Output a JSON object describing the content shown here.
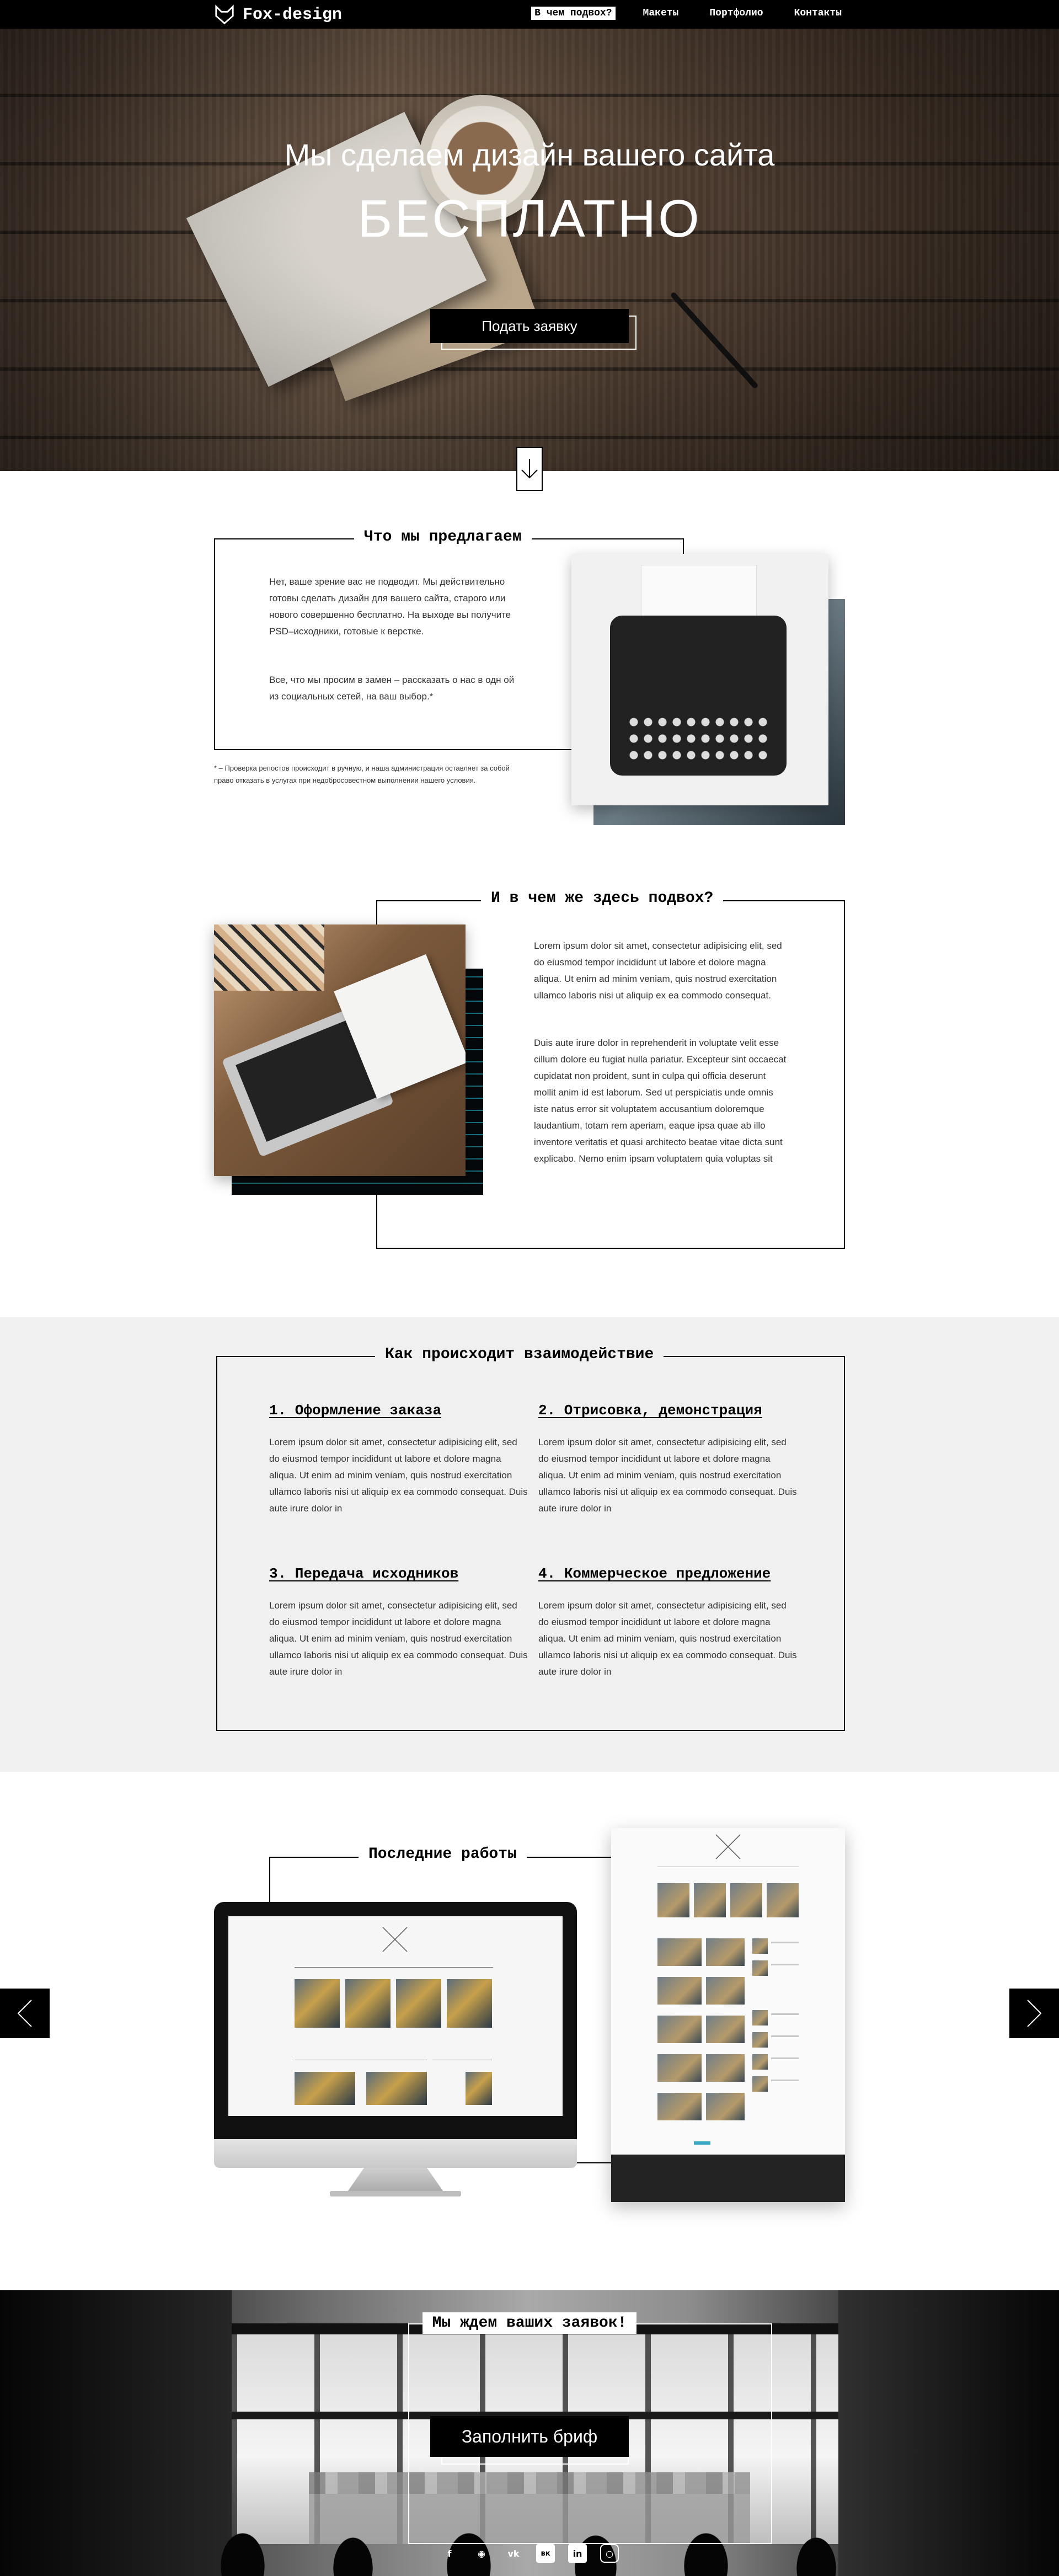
{
  "nav": {
    "brand": "Fox-design",
    "items": [
      {
        "label": "В чем подвох?",
        "active": true
      },
      {
        "label": "Макеты",
        "active": false
      },
      {
        "label": "Портфолио",
        "active": false
      },
      {
        "label": "Контакты",
        "active": false
      }
    ]
  },
  "hero": {
    "subtitle": "Мы сделаем дизайн вашего сайта",
    "title": "БЕСПЛАТНО",
    "button_label": "Подать заявку",
    "scroll_icon": "arrow-down-icon"
  },
  "offer": {
    "title": "Что мы предлагаем",
    "paragraph1": "Нет, ваше зрение вас не подводит. Мы действительно готовы сделать дизайн для вашего сайта, старого или нового совершенно бесплатно. На выходе вы получите PSD–исходники, готовые к верстке.",
    "paragraph2": "Все, что мы просим в замен – рассказать о нас в одн ой из социальных сетей, на ваш выбор.*",
    "footnote": "* – Проверка репостов происходит в ручную, и наша администрация оставляет за собой право отказать в услугах при недобросовестном выполнении нашего условия."
  },
  "catch": {
    "title": "И в чем же здесь подвох?",
    "paragraph1": "Lorem ipsum dolor sit amet, consectetur adipisicing elit, sed do eiusmod tempor incididunt ut labore et dolore magna aliqua. Ut enim ad minim veniam, quis nostrud exercitation ullamco laboris nisi ut aliquip ex ea commodo consequat.",
    "paragraph2": "Duis aute irure dolor in reprehenderit in voluptate velit esse cillum dolore eu fugiat nulla pariatur. Excepteur sint occaecat cupidatat non proident, sunt in culpa qui officia deserunt mollit anim id est laborum. Sed ut perspiciatis unde omnis iste natus error sit voluptatem accusantium doloremque laudantium, totam rem aperiam, eaque ipsa quae ab illo inventore veritatis et quasi architecto beatae vitae dicta sunt explicabo. Nemo enim ipsam voluptatem quia voluptas sit"
  },
  "process": {
    "title": "Как происходит взаимодействие",
    "steps": [
      {
        "title": "1. Оформление заказа",
        "text": "Lorem ipsum dolor sit amet, consectetur adipisicing elit, sed do eiusmod tempor incididunt ut labore et dolore magna aliqua. Ut enim ad minim veniam, quis nostrud exercitation ullamco laboris nisi ut aliquip ex ea commodo consequat. Duis aute irure dolor in"
      },
      {
        "title": "2. Отрисовка, демонстрация",
        "text": "Lorem ipsum dolor sit amet, consectetur adipisicing elit, sed do eiusmod tempor incididunt ut labore et dolore magna aliqua. Ut enim ad minim veniam, quis nostrud exercitation ullamco laboris nisi ut aliquip ex ea commodo consequat. Duis aute irure dolor in"
      },
      {
        "title": "3. Передача исходников",
        "text": "Lorem ipsum dolor sit amet, consectetur adipisicing elit, sed do eiusmod tempor incididunt ut labore et dolore magna aliqua. Ut enim ad minim veniam, quis nostrud exercitation ullamco laboris nisi ut aliquip ex ea commodo consequat. Duis aute irure dolor in"
      },
      {
        "title": "4. Коммерческое предложение",
        "text": "Lorem ipsum dolor sit amet, consectetur adipisicing elit, sed do eiusmod tempor incididunt ut labore et dolore magna aliqua. Ut enim ad minim veniam, quis nostrud exercitation ullamco laboris nisi ut aliquip ex ea commodo consequat. Duis aute irure dolor in"
      }
    ]
  },
  "portfolio": {
    "title": "Последние работы",
    "prev_icon": "chevron-left-icon",
    "next_icon": "chevron-right-icon"
  },
  "cta": {
    "title": "Мы ждем ваших заявок!",
    "button_label": "Заполнить бриф",
    "socials": [
      "facebook-icon",
      "odnoklassniki-icon",
      "vk-icon",
      "vkontakte-square-icon",
      "linkedin-icon",
      "instagram-icon"
    ]
  }
}
